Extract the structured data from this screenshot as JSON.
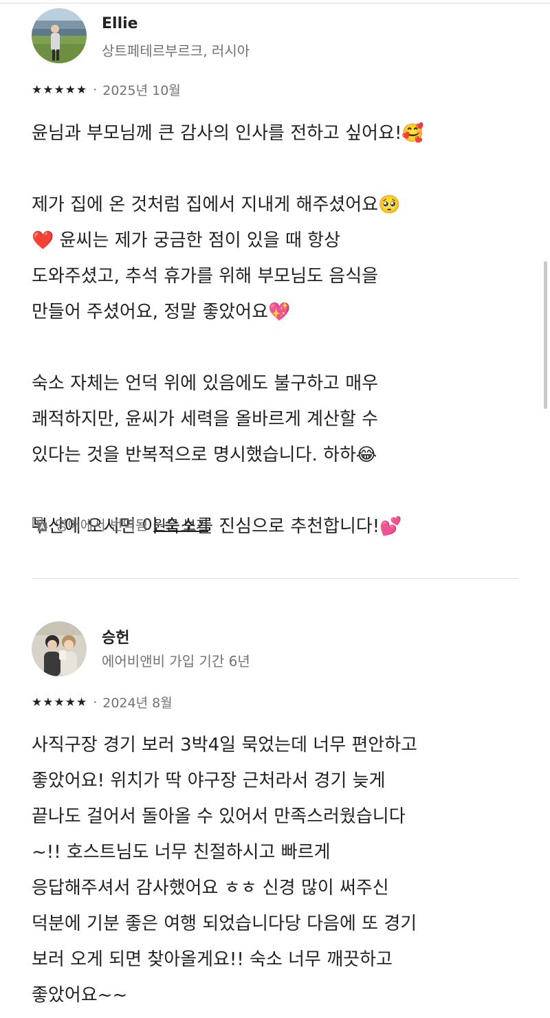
{
  "reviews": [
    {
      "name": "Ellie",
      "subtitle": "상트페테르부르크, 러시아",
      "stars": "★★★★★",
      "date": "2025년 10월",
      "paragraphs": [
        "윤님과 부모님께 큰 감사의 인사를 전하고 싶어요!🥰",
        "제가 집에 온 것처럼 집에서 지내게 해주셨어요🥺\n❤️ 윤씨는 제가 궁금한 점이 있을 때 항상\n도와주셨고, 추석 휴가를 위해 부모님도 음식을\n만들어 주셨어요, 정말 좋았어요💖",
        "숙소 자체는 언덕 위에 있음에도 불구하고 매우\n쾌적하지만, 윤씨가 세력을 올바르게 계산할 수\n있다는 것을 반복적으로 명시했습니다. 하하😂",
        "부산에 오시면 이 숙소를 진심으로 추천합니다!💕"
      ],
      "translated_label": "영어에서 번역됨",
      "original_link": "원문 보기"
    },
    {
      "name": "승헌",
      "subtitle": "에어비앤비 가입 기간 6년",
      "stars": "★★★★★",
      "date": "2024년 8월",
      "paragraphs": [
        "사직구장 경기 보러 3박4일 묵었는데 너무 편안하고\n좋았어요! 위치가 딱 야구장 근처라서 경기 늦게\n끝나도 걸어서 돌아올 수 있어서 만족스러웠습니다\n~!! 호스트님도 너무 친절하시고 빠르게\n응답해주셔서 감사했어요 ㅎㅎ 신경 많이 써주신\n덕분에 기분 좋은 여행 되었습니다당 다음에 또 경기\n보러 오게 되면 찾아올게요!! 숙소 너무 깨끗하고\n좋았어요~~"
      ]
    }
  ]
}
